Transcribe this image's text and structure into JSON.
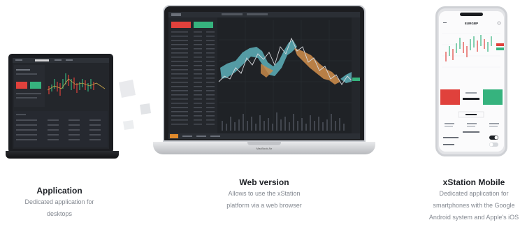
{
  "products": [
    {
      "title": "Application",
      "description_lines": [
        "Dedicated application for",
        "desktops"
      ]
    },
    {
      "title": "Web version",
      "description_lines": [
        "Allows to use the xStation",
        "platform via a web browser"
      ]
    },
    {
      "title": "xStation Mobile",
      "description_lines": [
        "Dedicated application for",
        "smartphones with the Google",
        "Android system and Apple's iOS"
      ]
    }
  ],
  "devices": {
    "desktop_laptop_brand": "MacBook Air",
    "mobile_symbol": "EURGBP"
  },
  "colors": {
    "buy": "#36b37e",
    "sell": "#e0413c",
    "chart_teal": "#5aa8b3",
    "chart_orange": "#c9894a",
    "screen_dark": "#1f2226"
  }
}
